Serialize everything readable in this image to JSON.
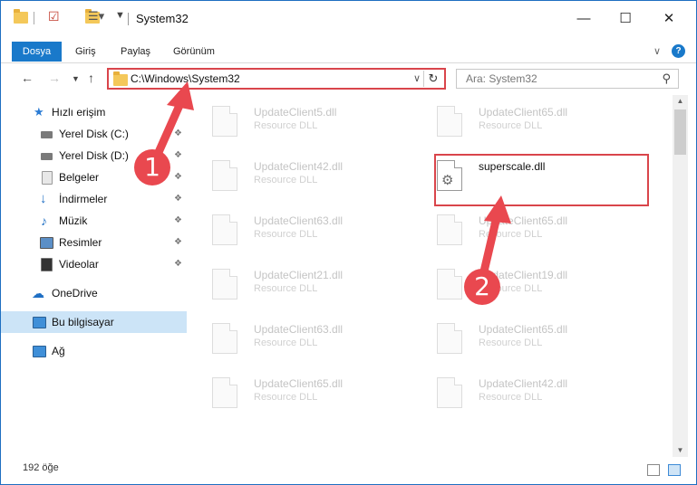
{
  "window": {
    "title": "System32",
    "minimize": "—",
    "maximize": "☐",
    "close": "✕"
  },
  "ribbon": {
    "tabs": [
      "Dosya",
      "Giriş",
      "Paylaş",
      "Görünüm"
    ],
    "expand": "∨",
    "help": "?"
  },
  "address": {
    "path": "C:\\Windows\\System32",
    "search_placeholder": "Ara: System32"
  },
  "sidebar": {
    "quick_access": "Hızlı erişim",
    "items": [
      {
        "label": "Yerel Disk (C:)",
        "icon": "drive-icon"
      },
      {
        "label": "Yerel Disk (D:)",
        "icon": "drive-icon"
      },
      {
        "label": "Belgeler",
        "icon": "documents-icon"
      },
      {
        "label": "İndirmeler",
        "icon": "downloads-icon"
      },
      {
        "label": "Müzik",
        "icon": "music-icon"
      },
      {
        "label": "Resimler",
        "icon": "pictures-icon"
      },
      {
        "label": "Videolar",
        "icon": "videos-icon"
      }
    ],
    "onedrive": "OneDrive",
    "this_pc": "Bu bilgisayar",
    "network": "Ağ"
  },
  "files": {
    "left": [
      {
        "name": "UpdateClient5.dll",
        "desc": "Resource DLL"
      },
      {
        "name": "UpdateClient42.dll",
        "desc": "Resource DLL"
      },
      {
        "name": "UpdateClient63.dll",
        "desc": "Resource DLL"
      },
      {
        "name": "UpdateClient21.dll",
        "desc": "Resource DLL"
      },
      {
        "name": "UpdateClient63.dll",
        "desc": "Resource DLL"
      },
      {
        "name": "UpdateClient65.dll",
        "desc": "Resource DLL"
      }
    ],
    "right": [
      {
        "name": "UpdateClient65.dll",
        "desc": "Resource DLL"
      },
      {
        "name": "superscale.dll",
        "desc": ""
      },
      {
        "name": "UpdateClient65.dll",
        "desc": "Resource DLL"
      },
      {
        "name": "UpdateClient19.dll",
        "desc": "Resource DLL"
      },
      {
        "name": "UpdateClient65.dll",
        "desc": "Resource DLL"
      },
      {
        "name": "UpdateClient42.dll",
        "desc": "Resource DLL"
      }
    ]
  },
  "status": {
    "count": "192 öğe"
  },
  "annotations": {
    "badge1": "1",
    "badge2": "2",
    "color": "#e9484f"
  }
}
